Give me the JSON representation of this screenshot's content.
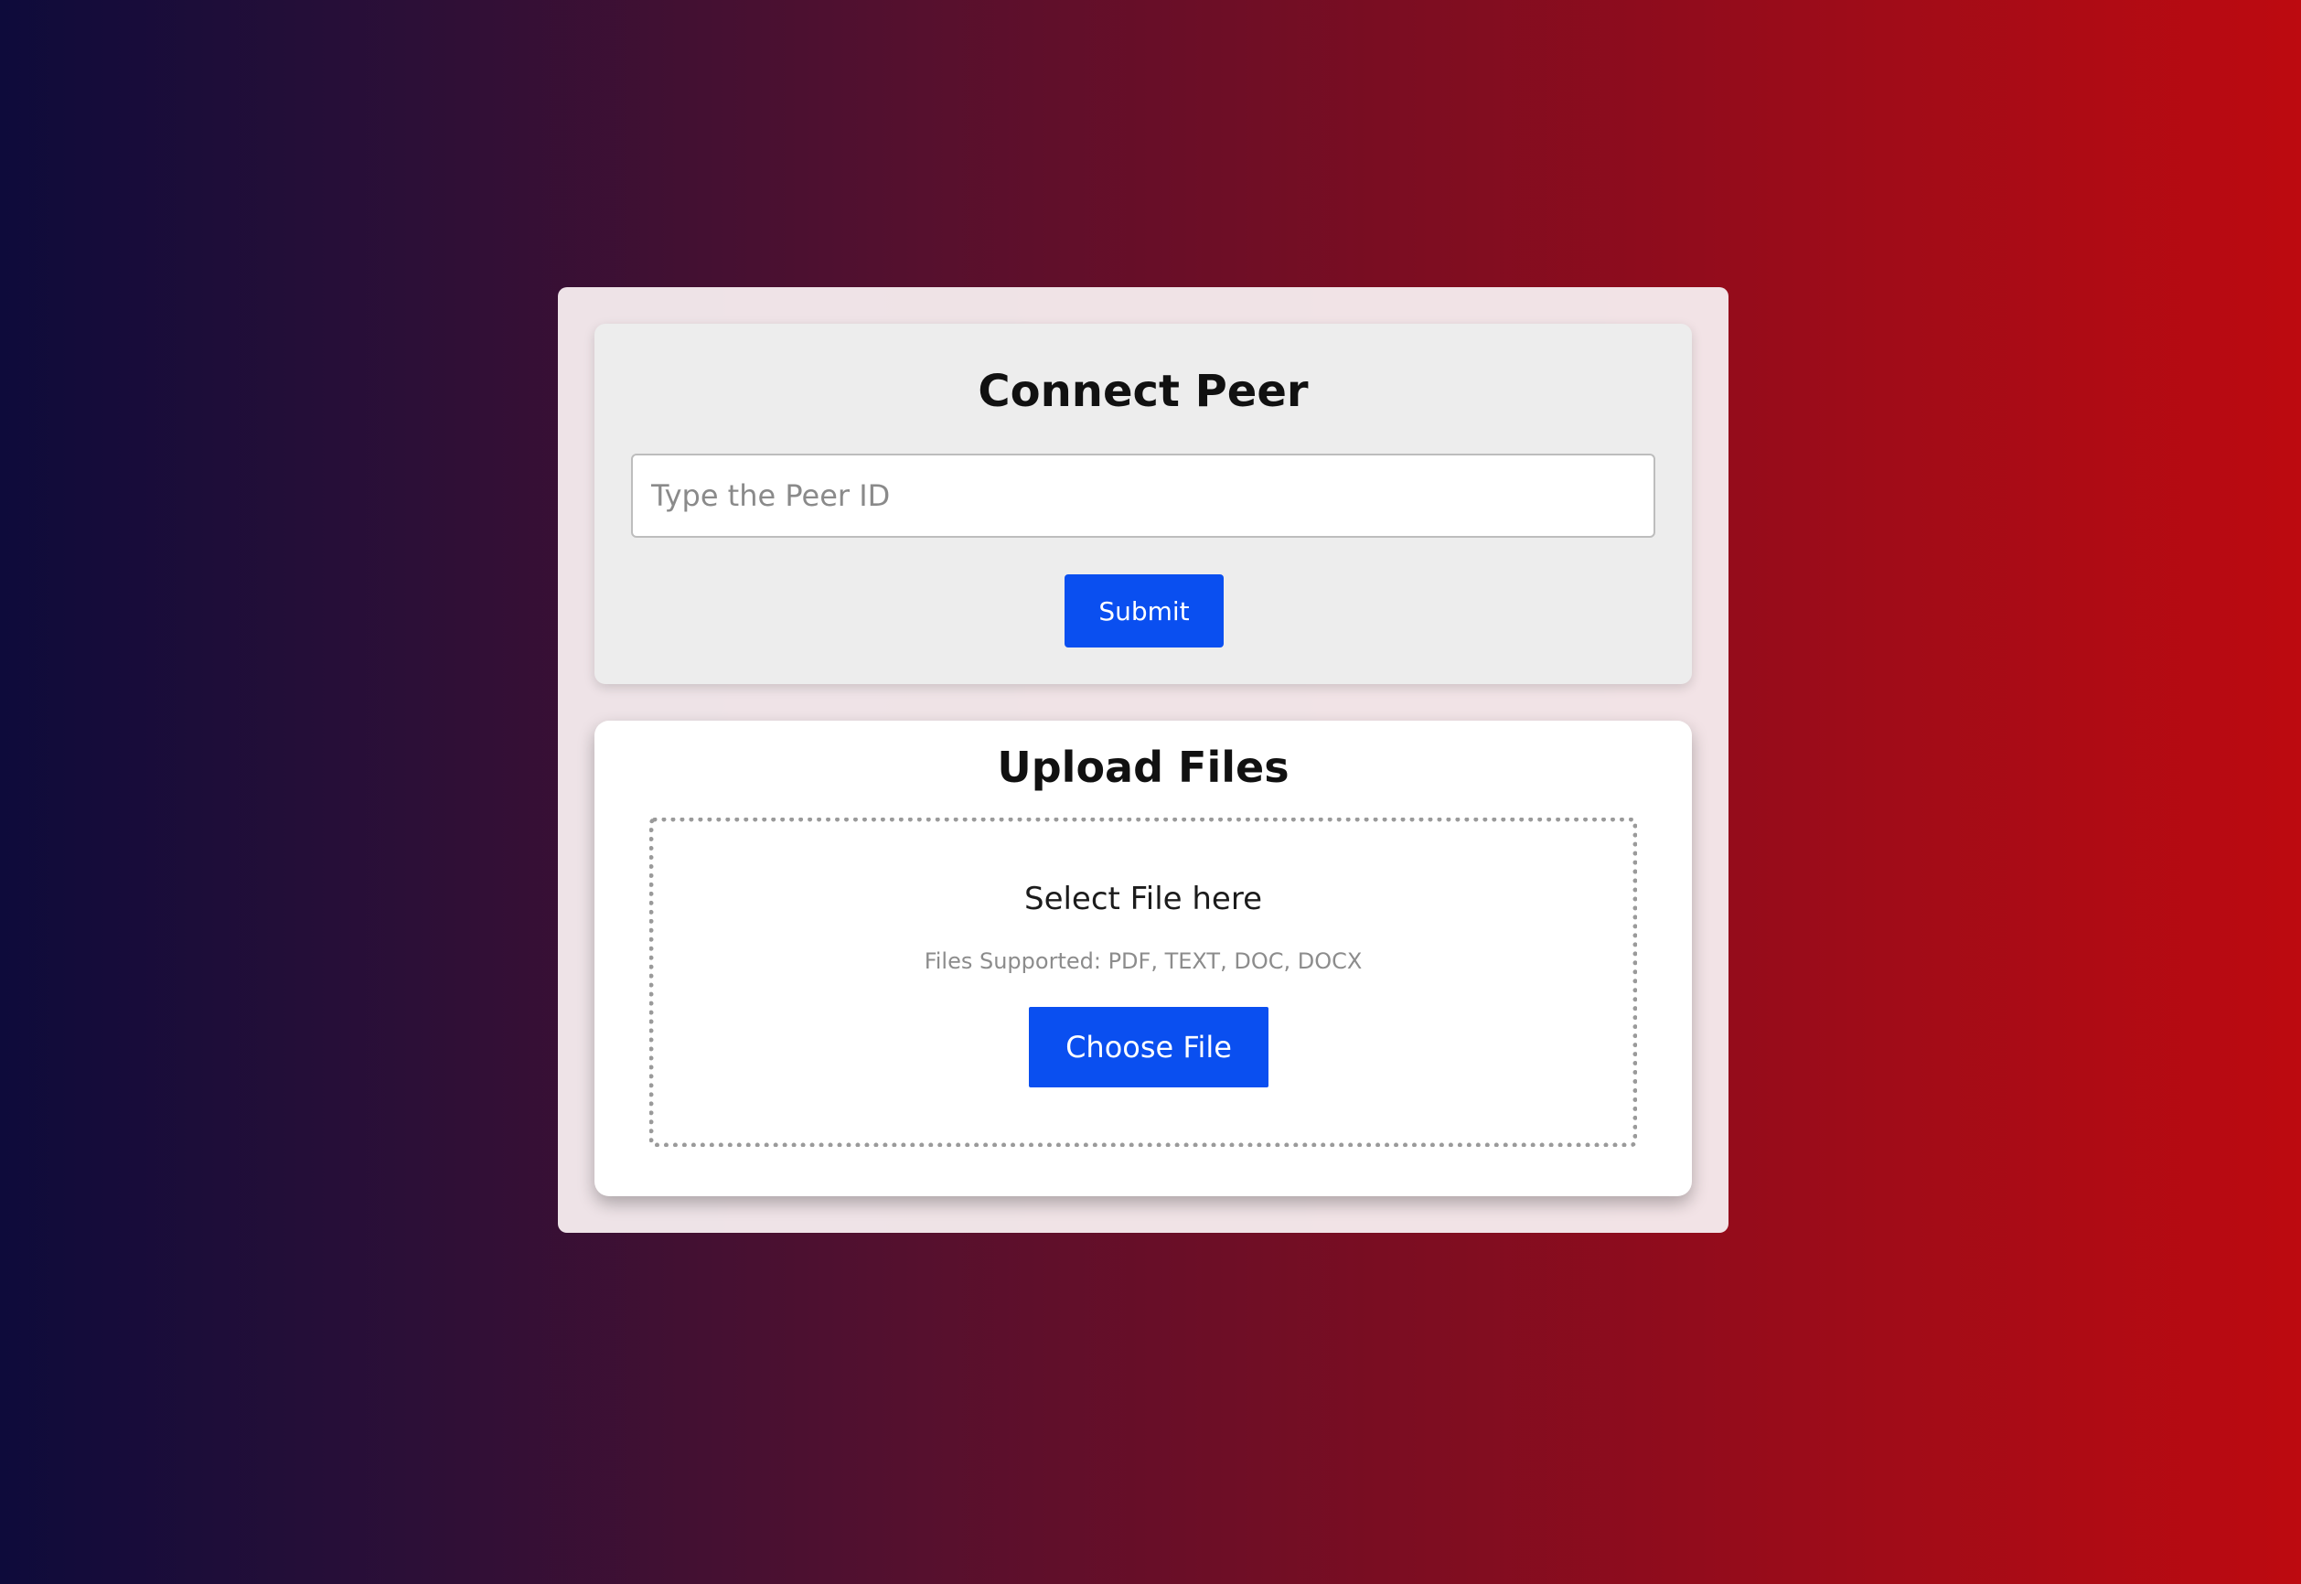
{
  "connect": {
    "title": "Connect Peer",
    "input_placeholder": "Type the Peer ID",
    "input_value": "",
    "submit_label": "Submit"
  },
  "upload": {
    "title": "Upload Files",
    "select_text": "Select File here",
    "supported_text": "Files Supported: PDF, TEXT, DOC, DOCX",
    "choose_label": "Choose File"
  },
  "colors": {
    "button_blue": "#0a4ff0",
    "background_left": "#0e0b3b",
    "background_right": "#bd0a10"
  }
}
